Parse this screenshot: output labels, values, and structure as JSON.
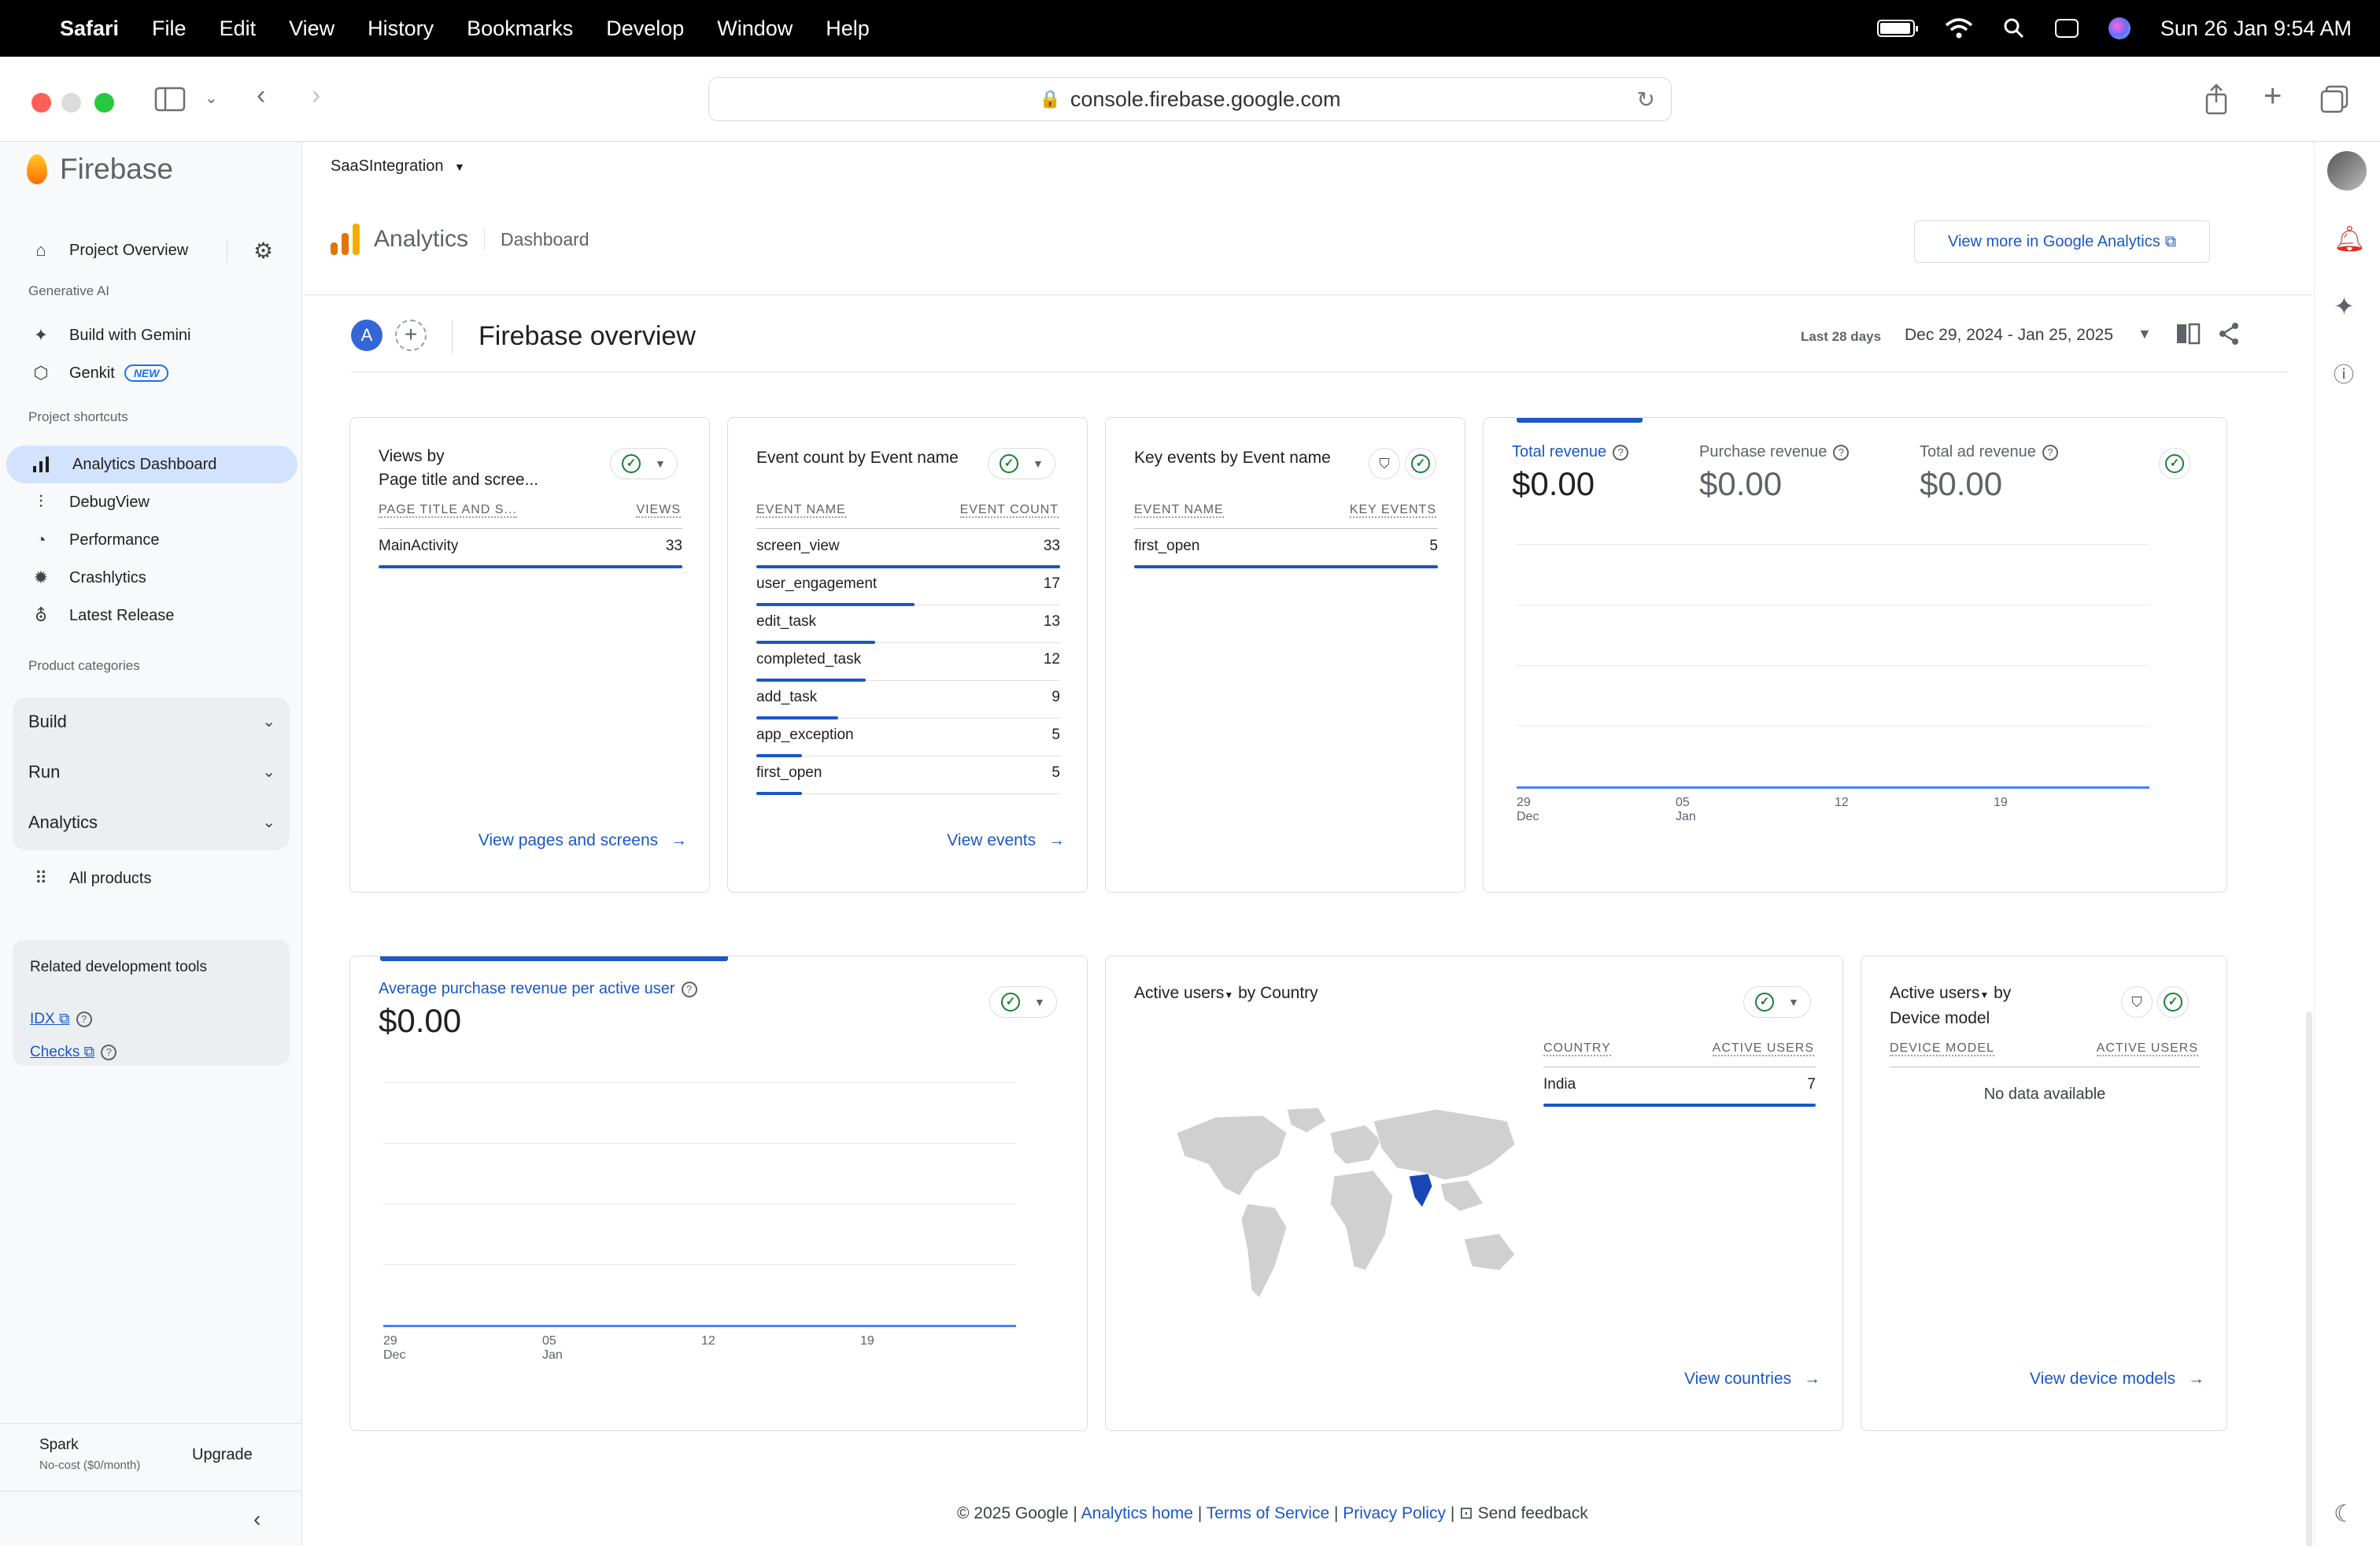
{
  "menubar": {
    "app": "Safari",
    "items": [
      "File",
      "Edit",
      "View",
      "History",
      "Bookmarks",
      "Develop",
      "Window",
      "Help"
    ],
    "clock": "Sun 26 Jan  9:54 AM"
  },
  "browser": {
    "url": "console.firebase.google.com"
  },
  "sidebar": {
    "brand": "Firebase",
    "project_overview": "Project Overview",
    "gen_ai_heading": "Generative AI",
    "gemini": "Build with Gemini",
    "genkit": "Genkit",
    "new_badge": "NEW",
    "shortcuts_heading": "Project shortcuts",
    "shortcuts": [
      "Analytics Dashboard",
      "DebugView",
      "Performance",
      "Crashlytics",
      "Latest Release"
    ],
    "categories_heading": "Product categories",
    "categories": [
      "Build",
      "Run",
      "Analytics"
    ],
    "all_products": "All products",
    "related_title": "Related development tools",
    "related_links": [
      "IDX",
      "Checks"
    ],
    "plan_name": "Spark",
    "plan_desc": "No-cost ($0/month)",
    "upgrade": "Upgrade"
  },
  "header": {
    "project": "SaaSIntegration",
    "title": "Analytics",
    "subtitle": "Dashboard",
    "ga_button": "View more in Google Analytics"
  },
  "overview": {
    "avatar": "A",
    "title": "Firebase overview",
    "date_label": "Last 28 days",
    "date_range": "Dec 29, 2024 - Jan 25, 2025"
  },
  "cards": {
    "views": {
      "title_1": "Views by",
      "title_2": "Page title and scree...",
      "col_1": "PAGE TITLE AND S...",
      "col_2": "VIEWS",
      "rows": [
        {
          "k": "MainActivity",
          "v": "33",
          "share": 1.0
        }
      ],
      "link": "View pages and screens"
    },
    "events": {
      "title": "Event count by Event name",
      "col_1": "EVENT NAME",
      "col_2": "EVENT COUNT",
      "rows": [
        {
          "k": "screen_view",
          "v": "33",
          "share": 1.0
        },
        {
          "k": "user_engagement",
          "v": "17",
          "share": 0.52
        },
        {
          "k": "edit_task",
          "v": "13",
          "share": 0.39
        },
        {
          "k": "completed_task",
          "v": "12",
          "share": 0.36
        },
        {
          "k": "add_task",
          "v": "9",
          "share": 0.27
        },
        {
          "k": "app_exception",
          "v": "5",
          "share": 0.15
        },
        {
          "k": "first_open",
          "v": "5",
          "share": 0.15
        }
      ],
      "link": "View events"
    },
    "key_events": {
      "title": "Key events by Event name",
      "col_1": "EVENT NAME",
      "col_2": "KEY EVENTS",
      "rows": [
        {
          "k": "first_open",
          "v": "5",
          "share": 1.0
        }
      ]
    },
    "revenue": {
      "metrics": [
        {
          "label": "Total revenue",
          "value": "$0.00"
        },
        {
          "label": "Purchase revenue",
          "value": "$0.00"
        },
        {
          "label": "Total ad revenue",
          "value": "$0.00"
        }
      ],
      "x_ticks": [
        {
          "d": "29",
          "m": "Dec"
        },
        {
          "d": "05",
          "m": "Jan"
        },
        {
          "d": "12",
          "m": ""
        },
        {
          "d": "19",
          "m": ""
        }
      ]
    },
    "arpu": {
      "label": "Average purchase revenue per active user",
      "value": "$0.00",
      "x_ticks": [
        {
          "d": "29",
          "m": "Dec"
        },
        {
          "d": "05",
          "m": "Jan"
        },
        {
          "d": "12",
          "m": ""
        },
        {
          "d": "19",
          "m": ""
        }
      ]
    },
    "country": {
      "title_metric": "Active users",
      "title_dim": "by Country",
      "col_1": "COUNTRY",
      "col_2": "ACTIVE USERS",
      "rows": [
        {
          "k": "India",
          "v": "7",
          "share": 1.0
        }
      ],
      "link": "View countries"
    },
    "device": {
      "title_metric": "Active users",
      "title_dim": "by",
      "title_2": "Device model",
      "col_1": "DEVICE MODEL",
      "col_2": "ACTIVE USERS",
      "empty": "No data available",
      "link": "View device models"
    }
  },
  "footer": {
    "copyright": "© 2025 Google |",
    "analytics_home": "Analytics home",
    "terms": "Terms of Service",
    "privacy": "Privacy Policy",
    "sep": "|",
    "feedback": "Send feedback"
  },
  "colors": {
    "accent": "#1a57c8",
    "active_bg": "#d3e3fd",
    "success": "#188038",
    "map_highlight": "#1a47b8"
  }
}
